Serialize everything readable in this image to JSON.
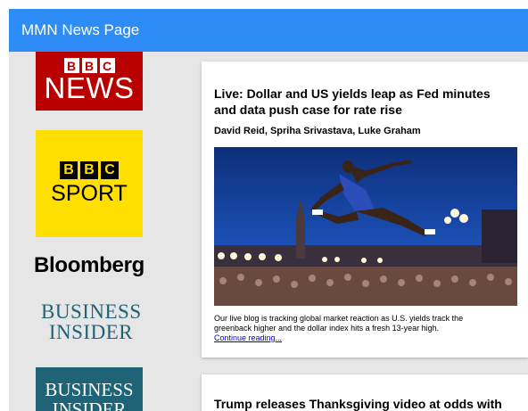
{
  "header": {
    "title": "MMN News Page"
  },
  "sidebar": {
    "sources": [
      {
        "name": "BBC News",
        "blocks": [
          "B",
          "B",
          "C"
        ],
        "word": "NEWS",
        "bg": "#b80000"
      },
      {
        "name": "BBC Sport",
        "blocks": [
          "B",
          "B",
          "C"
        ],
        "word": "SPORT",
        "bg": "#ffdf00"
      },
      {
        "name": "Bloomberg",
        "word": "Bloomberg"
      },
      {
        "name": "Business Insider",
        "line1": "BUSINESS",
        "line2": "INSIDER",
        "color": "#1f6377"
      },
      {
        "name": "Business Insider",
        "line1": "BUSINESS",
        "line2": "INSIDER",
        "bg": "#1f6377"
      }
    ]
  },
  "articles": [
    {
      "title": "Live: Dollar and US yields leap as Fed minutes and data push case for rate rise",
      "authors": "David Reid, Spriha Srivastava, Luke Graham",
      "summary": "Our live blog is tracking global market reaction as U.S. yields track the greenback higher and the dollar index hits a fresh 13-year high.",
      "link": "Continue reading..."
    },
    {
      "title": "Trump releases Thanksgiving video at odds with"
    }
  ],
  "colors": {
    "header": "#2d8cf6",
    "background": "#e6e6e6",
    "link": "#0000ee"
  }
}
